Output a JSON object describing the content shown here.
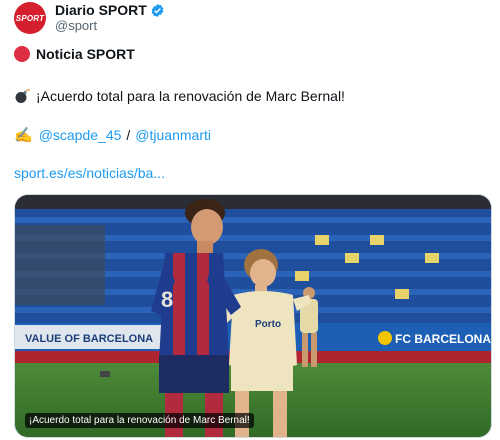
{
  "header": {
    "display_name": "Diario SPORT",
    "handle": "@sport",
    "avatar_text": "SPORT",
    "verified": true,
    "verified_color": "#1d9bf0",
    "avatar_color": "#d51f2e"
  },
  "tweet": {
    "line1_icon": "red-circle-emoji",
    "line1_text": "Noticia SPORT",
    "line2_icon": "bomb-emoji",
    "line2_text": "¡Acuerdo total para la renovación de Marc Bernal!",
    "line3_icon": "writing-hand-emoji",
    "mention1": "@scapde_45",
    "separator": "/",
    "mention2": "@tjuanmarti",
    "link": "sport.es/es/noticias/ba..."
  },
  "media": {
    "caption": "¡Acuerdo total para la renovación de Marc Bernal!",
    "jersey_text": "Porto",
    "banner_text": "FC BARCELONA",
    "board_text": "VALUE OF BARCELONA"
  },
  "colors": {
    "link": "#1d9bf0",
    "text": "#0f1419",
    "secondary": "#536471"
  }
}
